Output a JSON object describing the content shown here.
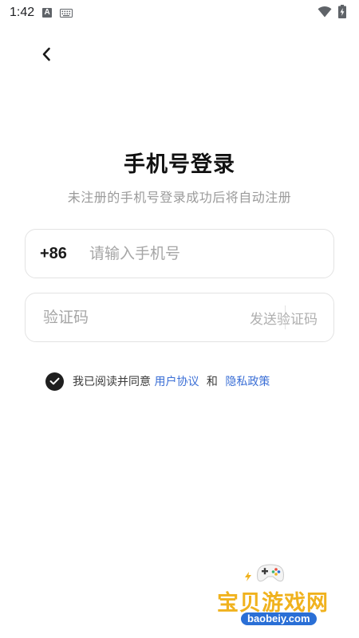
{
  "status_bar": {
    "time": "1:42",
    "icons": [
      "a-notification-icon",
      "keyboard-icon",
      "wifi-icon",
      "battery-charging-icon"
    ],
    "a_label": "A"
  },
  "header": {
    "back_icon": "chevron-left-icon"
  },
  "login": {
    "title": "手机号登录",
    "subtitle": "未注册的手机号登录成功后将自动注册",
    "country_code": "+86",
    "phone_placeholder": "请输入手机号",
    "phone_value": "",
    "code_placeholder": "验证码",
    "code_value": "",
    "send_code_label": "发送验证码"
  },
  "agreement": {
    "checked": true,
    "prefix": "我已阅读并同意",
    "user_agreement": "用户协议",
    "and": "和",
    "privacy_policy": "隐私政策"
  },
  "watermark": {
    "brand": "宝贝游戏网",
    "url": "baobeiy.com"
  },
  "colors": {
    "accent_link": "#3b6fd6",
    "check_fill": "#1f1f1f",
    "placeholder": "#a6a6a6",
    "border": "#e3e3e3"
  }
}
